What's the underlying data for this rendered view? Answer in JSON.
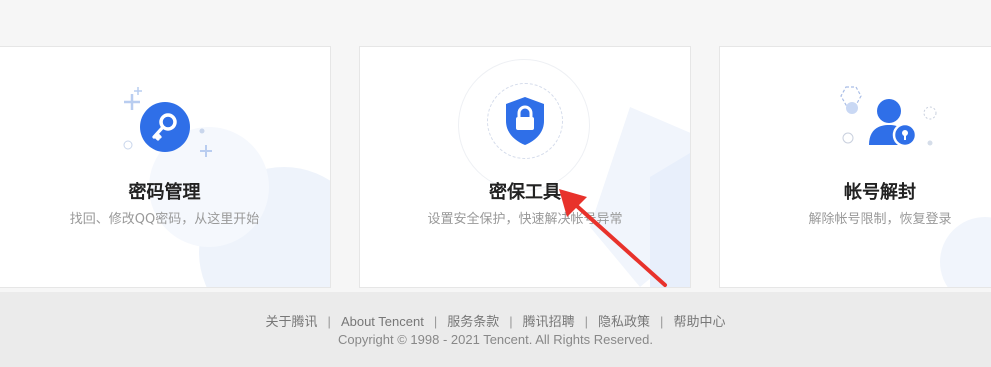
{
  "cards": [
    {
      "title": "密码管理",
      "desc": "找回、修改QQ密码，从这里开始",
      "icon": "key-icon",
      "accent": "#2f6fe8"
    },
    {
      "title": "密保工具",
      "desc": "设置安全保护，快速解决帐号异常",
      "icon": "shield-lock-icon",
      "accent": "#2f6fe8"
    },
    {
      "title": "帐号解封",
      "desc": "解除帐号限制，恢复登录",
      "icon": "user-unlock-icon",
      "accent": "#2f6fe8"
    }
  ],
  "footer": {
    "links": [
      "关于腾讯",
      "About Tencent",
      "服务条款",
      "腾讯招聘",
      "隐私政策",
      "帮助中心"
    ],
    "separator": "|",
    "copyright": "Copyright © 1998 - 2021 Tencent. All Rights Reserved."
  },
  "annotation": {
    "type": "red-arrow",
    "color": "#e8322b"
  }
}
